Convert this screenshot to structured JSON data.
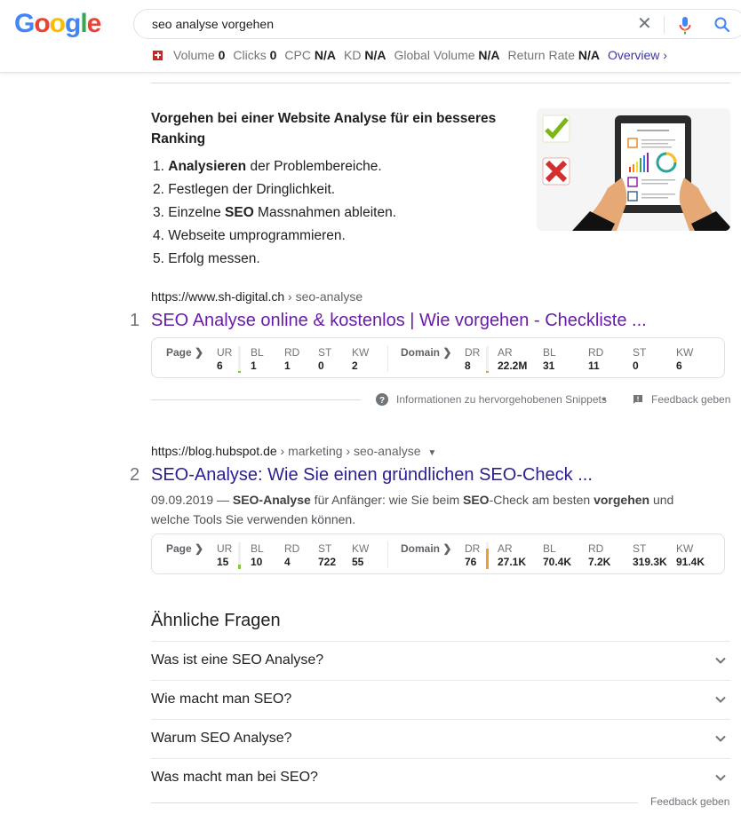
{
  "header": {
    "logo_letters": [
      {
        "char": "G",
        "color": "#4285f4"
      },
      {
        "char": "o",
        "color": "#ea4335"
      },
      {
        "char": "o",
        "color": "#fbbc05"
      },
      {
        "char": "g",
        "color": "#4285f4"
      },
      {
        "char": "l",
        "color": "#34a853"
      },
      {
        "char": "e",
        "color": "#ea4335"
      }
    ],
    "search_query": "seo analyse vorgehen",
    "icons": {
      "clear": "close-icon",
      "voice": "microphone-icon",
      "search": "search-icon"
    }
  },
  "keyword_metrics": {
    "flag": "switzerland-flag-icon",
    "items": [
      {
        "label": "Volume",
        "value": "0"
      },
      {
        "label": "Clicks",
        "value": "0"
      },
      {
        "label": "CPC",
        "value": "N/A"
      },
      {
        "label": "KD",
        "value": "N/A"
      },
      {
        "label": "Global Volume",
        "value": "N/A"
      },
      {
        "label": "Return Rate",
        "value": "N/A"
      }
    ],
    "overview_link": "Overview ›"
  },
  "featured_snippet": {
    "title": "Vorgehen bei einer Website Analyse für ein besseres Ranking",
    "list": [
      {
        "num": "1.",
        "bold": "Analysieren",
        "pre": "",
        "post": " der Problembereiche."
      },
      {
        "num": "2.",
        "bold": "",
        "pre": "Festlegen der Dringlichkeit.",
        "post": ""
      },
      {
        "num": "3.",
        "bold": "SEO",
        "pre": "Einzelne ",
        "post": " Massnahmen ableiten."
      },
      {
        "num": "4.",
        "bold": "",
        "pre": "Webseite umprogrammieren.",
        "post": ""
      },
      {
        "num": "5.",
        "bold": "",
        "pre": "Erfolg messen.",
        "post": ""
      }
    ],
    "image_alt": "tablet-checklist-illustration"
  },
  "results": [
    {
      "rank": "1",
      "url_domain": "https://www.sh-digital.ch",
      "url_path": " › seo-analyse",
      "title": "SEO Analyse online & kostenlos | Wie vorgehen - Checkliste ...",
      "ahrefs": {
        "page_label": "Page ❯",
        "domain_label": "Domain ❯",
        "page": [
          {
            "label": "UR",
            "value": "6",
            "bar_pct": 6,
            "bar_color": "#8bc34a"
          },
          {
            "label": "BL",
            "value": "1"
          },
          {
            "label": "RD",
            "value": "1"
          },
          {
            "label": "ST",
            "value": "0"
          },
          {
            "label": "KW",
            "value": "2"
          }
        ],
        "domain": [
          {
            "label": "DR",
            "value": "8",
            "bar_pct": 8,
            "bar_color": "#e8a033"
          },
          {
            "label": "AR",
            "value": "22.2M"
          },
          {
            "label": "BL",
            "value": "31"
          },
          {
            "label": "RD",
            "value": "11"
          },
          {
            "label": "ST",
            "value": "0"
          },
          {
            "label": "KW",
            "value": "6"
          }
        ]
      }
    },
    {
      "rank": "2",
      "url_domain": "https://blog.hubspot.de",
      "url_path": " › marketing › seo-analyse",
      "title": "SEO-Analyse: Wie Sie einen gründlichen SEO-Check ...",
      "snippet_parts": [
        {
          "t": "09.09.2019 — ",
          "b": false
        },
        {
          "t": "SEO-Analyse",
          "b": true
        },
        {
          "t": " für Anfänger: wie Sie beim ",
          "b": false
        },
        {
          "t": "SEO",
          "b": true
        },
        {
          "t": "-Check am besten ",
          "b": false
        },
        {
          "t": "vorgehen",
          "b": true
        },
        {
          "t": " und welche Tools Sie verwenden können.",
          "b": false
        }
      ],
      "ahrefs": {
        "page_label": "Page ❯",
        "domain_label": "Domain ❯",
        "page": [
          {
            "label": "UR",
            "value": "15",
            "bar_pct": 15,
            "bar_color": "#8bc34a"
          },
          {
            "label": "BL",
            "value": "10"
          },
          {
            "label": "RD",
            "value": "4"
          },
          {
            "label": "ST",
            "value": "722"
          },
          {
            "label": "KW",
            "value": "55"
          }
        ],
        "domain": [
          {
            "label": "DR",
            "value": "76",
            "bar_pct": 76,
            "bar_color": "#e8a033"
          },
          {
            "label": "AR",
            "value": "27.1K"
          },
          {
            "label": "BL",
            "value": "70.4K"
          },
          {
            "label": "RD",
            "value": "7.2K"
          },
          {
            "label": "ST",
            "value": "319.3K"
          },
          {
            "label": "KW",
            "value": "91.4K"
          }
        ]
      }
    }
  ],
  "snippet_footer": {
    "info_text": "Informationen zu hervorgehobenen Snippets",
    "dot": "•",
    "feedback_text": "Feedback geben"
  },
  "paa": {
    "heading": "Ähnliche Fragen",
    "questions": [
      "Was ist eine SEO Analyse?",
      "Wie macht man SEO?",
      "Warum SEO Analyse?",
      "Was macht man bei SEO?"
    ],
    "feedback_text": "Feedback geben"
  }
}
